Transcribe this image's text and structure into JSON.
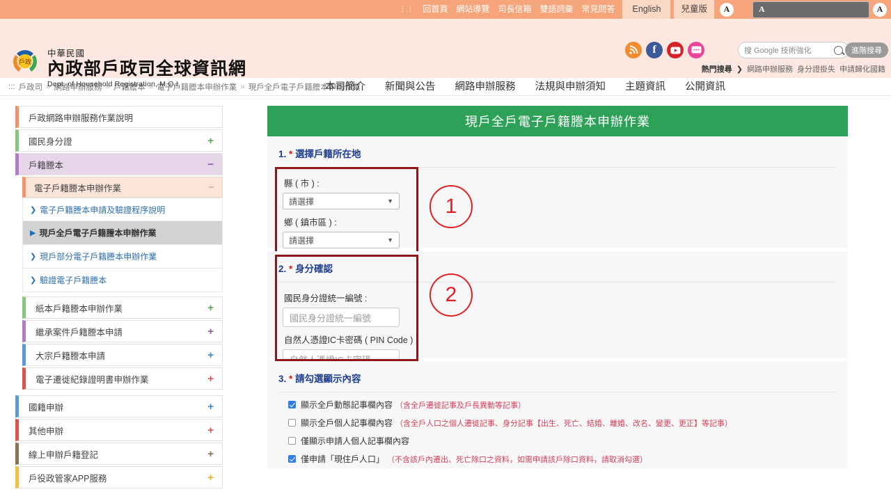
{
  "topbar": {
    "dots": "⋮⋮",
    "links": [
      "回首頁",
      "網站導覽",
      "司長信箱",
      "雙語詞彙",
      "常見問答"
    ],
    "english_label": "English",
    "kids_label": "兒童版",
    "font_sizes": [
      "A",
      "A",
      "A"
    ],
    "font_size_selected_index": 1,
    "bar_color": "#f6a479"
  },
  "header": {
    "logo": {
      "emblem_text": "戶政",
      "small_title": "中華民國",
      "main_title": "內政部戶政司全球資訊網",
      "english_title": "Dept. of Household Registration, M.O.I."
    },
    "social_icons": [
      {
        "name": "rss-icon",
        "glyph": "≋",
        "color": "#f28a2e"
      },
      {
        "name": "facebook-icon",
        "glyph": "f",
        "color": "#3b5998"
      },
      {
        "name": "youtube-icon",
        "glyph": "▶",
        "color": "#d42428"
      },
      {
        "name": "chat-icon",
        "glyph": "···",
        "color": "#e8459b"
      }
    ],
    "search": {
      "placeholder": "搜 Google 技術強化",
      "google_word": "Google",
      "prefix": "搜",
      "suffix": "技術強化",
      "advanced_label": "進階搜尋"
    },
    "hot_search": {
      "label": "熱門搜尋",
      "arrow": "❯",
      "items": [
        "網路申辦服務",
        "身分證掛失",
        "申請歸化國籍"
      ]
    },
    "nav_dots": "⋮⋮",
    "nav_items": [
      "本司簡介",
      "新聞與公告",
      "網路申辦服務",
      "法規與申辦須知",
      "主題資訊",
      "公開資訊"
    ],
    "bg_color": "#fce8e0"
  },
  "breadcrumb": {
    "prefix": ":::",
    "items": [
      "戶政司",
      "網路申辦服務",
      "戶籍謄本",
      "電子戶籍謄本申辦作業",
      "現戶全戶電子戶籍謄本申辦作業"
    ],
    "separator": "»"
  },
  "sidebar": {
    "items": [
      {
        "label": "戶政網路申辦服務作業說明",
        "accent": "#f0936a",
        "toggle": "",
        "type": "plain"
      },
      {
        "label": "國民身分證",
        "accent": "#8cc47c",
        "toggle": "+",
        "toggle_color": "#5aa84f",
        "type": "plain"
      },
      {
        "label": "戶籍謄本",
        "accent": "#b07cc0",
        "toggle": "−",
        "toggle_color": "#8e5fa0",
        "type": "expanded"
      },
      {
        "label": "電子戶籍謄本申辦作業",
        "accent": "#f0936a",
        "toggle": "−",
        "toggle_color": "#d8703f",
        "type": "sub"
      },
      {
        "label": "電子戶籍謄本申請及驗證程序說明",
        "arrow": "❯",
        "type": "leaf"
      },
      {
        "label": "現戶全戶電子戶籍謄本申辦作業",
        "arrow": "▶",
        "type": "leaf-active"
      },
      {
        "label": "現戶部分電子戶籍謄本申辦作業",
        "arrow": "❯",
        "type": "leaf"
      },
      {
        "label": "驗證電子戶籍謄本",
        "arrow": "❯",
        "type": "leaf"
      },
      {
        "label": "紙本戶籍謄本申辦作業",
        "accent": "#8cc47c",
        "toggle": "+",
        "toggle_color": "#5aa84f",
        "type": "indent"
      },
      {
        "label": "繼承案件戶籍謄本申請",
        "accent": "#b07cc0",
        "toggle": "+",
        "toggle_color": "#8e5fa0",
        "type": "indent"
      },
      {
        "label": "大宗戶籍謄本申請",
        "accent": "#5b9bd5",
        "toggle": "+",
        "toggle_color": "#3d8ad1",
        "type": "indent"
      },
      {
        "label": "電子遷徙紀錄證明書申辦作業",
        "accent": "#d9534f",
        "toggle": "+",
        "toggle_color": "#d9534f",
        "type": "indent"
      },
      {
        "label": "國籍申辦",
        "accent": "#5b9bd5",
        "toggle": "+",
        "toggle_color": "#3d8ad1",
        "type": "plain"
      },
      {
        "label": "其他申辦",
        "accent": "#d9534f",
        "toggle": "+",
        "toggle_color": "#d9534f",
        "type": "plain"
      },
      {
        "label": "線上申辦戶籍登記",
        "accent": "#8a7354",
        "toggle": "+",
        "toggle_color": "#8a7354",
        "type": "plain"
      },
      {
        "label": "戶役政管家APP服務",
        "accent": "#f0c040",
        "toggle": "+",
        "toggle_color": "#f0b020",
        "type": "plain"
      }
    ]
  },
  "main": {
    "panel_title": "現戶全戶電子戶籍謄本申辦作業",
    "panel_title_color": "#2da158",
    "section1": {
      "number": "1.",
      "star": "*",
      "title": "選擇戶籍所在地",
      "annotation": "1",
      "fields": [
        {
          "label": "縣 ( 市 ) :",
          "value": "請選擇"
        },
        {
          "label": "鄉 ( 鎮市區 ) :",
          "value": "請選擇"
        }
      ]
    },
    "section2": {
      "number": "2.",
      "star": "*",
      "title": "身分確認",
      "annotation": "2",
      "fields": [
        {
          "label": "國民身分證統一編號 :",
          "placeholder": "國民身分證統一編號"
        },
        {
          "label": "自然人憑證IC卡密碼 ( PIN Code ) :",
          "placeholder": "自然人憑證IC卡密碼"
        }
      ]
    },
    "section3": {
      "number": "3.",
      "star": "*",
      "title": "請勾選顯示內容",
      "checkboxes": [
        {
          "checked": true,
          "label": "顯示全戶動態記事欄內容",
          "note": "（含全戶遷徙記事及戶長異動等記事）"
        },
        {
          "checked": false,
          "label": "顯示全戶個人記事欄內容",
          "note": "（含全戶人口之個人遷徙記事、身分記事【出生、死亡、結婚、離婚、改名、變更、更正】等記事）"
        },
        {
          "checked": false,
          "label": "僅顯示申請人個人記事欄內容",
          "note": ""
        },
        {
          "checked": true,
          "label": "僅申請「現住戶人口」",
          "note": "（不含該戶內遷出、死亡除口之資料，如需申請該戶除口資料，請取消勾選）"
        }
      ]
    }
  }
}
